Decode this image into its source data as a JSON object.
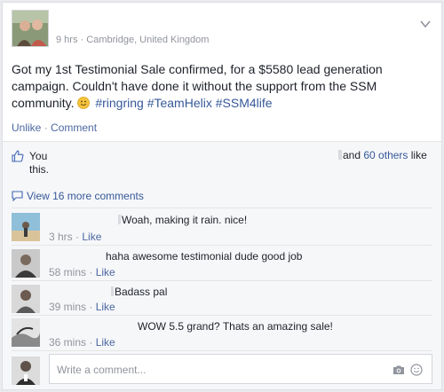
{
  "post": {
    "time": "9 hrs",
    "location": "Cambridge, United Kingdom",
    "text_main": "Got my 1st Testimonial Sale confirmed, for a $5580 lead generation campaign. Couldn't have done it without the support from the SSM community.",
    "hashtags": [
      "#ringring",
      "#TeamHelix",
      "#SSM4life"
    ],
    "actions": {
      "unlike": "Unlike",
      "comment": "Comment"
    }
  },
  "likes": {
    "you": "You",
    "continuation": "this.",
    "and": "and",
    "others_link": "60 others",
    "like_suffix": "like"
  },
  "comments": {
    "view_more": "View 16 more comments",
    "items": [
      {
        "text": "Woah, making it rain. nice!",
        "time": "3 hrs",
        "like": "Like"
      },
      {
        "text": "haha awesome testimonial dude good job",
        "time": "58 mins",
        "like": "Like"
      },
      {
        "text": "Badass pal",
        "time": "39 mins",
        "like": "Like"
      },
      {
        "text": "WOW 5.5 grand? Thats an amazing sale!",
        "time": "36 mins",
        "like": "Like"
      }
    ]
  },
  "composer": {
    "placeholder": "Write a comment..."
  },
  "colors": {
    "link": "#365899",
    "meta": "#90949c",
    "hashtag": "#365899",
    "background": "#f6f7f9"
  }
}
